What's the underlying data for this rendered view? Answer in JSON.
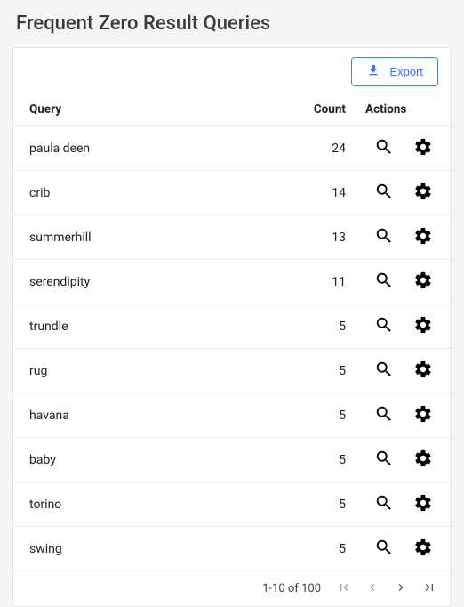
{
  "title": "Frequent Zero Result Queries",
  "toolbar": {
    "export_label": "Export"
  },
  "table": {
    "headers": {
      "query": "Query",
      "count": "Count",
      "actions": "Actions"
    },
    "rows": [
      {
        "query": "paula deen",
        "count": 24
      },
      {
        "query": "crib",
        "count": 14
      },
      {
        "query": "summerhill",
        "count": 13
      },
      {
        "query": "serendipity",
        "count": 11
      },
      {
        "query": "trundle",
        "count": 5
      },
      {
        "query": "rug",
        "count": 5
      },
      {
        "query": "havana",
        "count": 5
      },
      {
        "query": "baby",
        "count": 5
      },
      {
        "query": "torino",
        "count": 5
      },
      {
        "query": "swing",
        "count": 5
      }
    ]
  },
  "pagination": {
    "range_text": "1-10 of 100"
  }
}
